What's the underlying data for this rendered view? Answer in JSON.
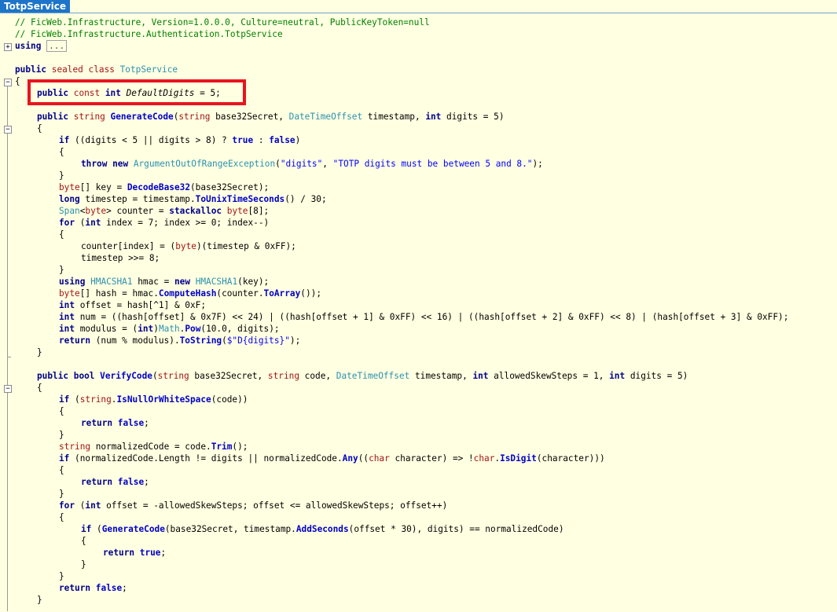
{
  "tab": {
    "title": "TotpService"
  },
  "highlight_label": "red box around DefaultDigits constant",
  "lines": [
    "// FicWeb.Infrastructure, Version=1.0.0.0, Culture=neutral, PublicKeyToken=null",
    "// FicWeb.Infrastructure.Authentication.TotpService",
    "using",
    "...",
    "public sealed class TotpService",
    "{",
    "public const int DefaultDigits = 5;",
    "public string GenerateCode(string base32Secret, DateTimeOffset timestamp, int digits = 5)",
    "if ((digits < 5 || digits > 8) ? true : false)",
    "throw new ArgumentOutOfRangeException(\"digits\", \"TOTP digits must be between 5 and 8.\");",
    "byte[] key = DecodeBase32(base32Secret);",
    "long timestep = timestamp.ToUnixTimeSeconds() / 30;",
    "Span<byte> counter = stackalloc byte[8];",
    "for (int index = 7; index >= 0; index--)",
    "counter[index] = (byte)(timestep & 0xFF);",
    "timestep >>= 8;",
    "using HMACSHA1 hmac = new HMACSHA1(key);",
    "byte[] hash = hmac.ComputeHash(counter.ToArray());",
    "int offset = hash[^1] & 0xF;",
    "int num = ((hash[offset] & 0x7F) << 24) | ((hash[offset + 1] & 0xFF) << 16) | ((hash[offset + 2] & 0xFF) << 8) | (hash[offset + 3] & 0xFF);",
    "int modulus = (int)Math.Pow(10.0, digits);",
    "return (num % modulus).ToString($\"D{digits}\");",
    "public bool VerifyCode(string base32Secret, string code, DateTimeOffset timestamp, int allowedSkewSteps = 1, int digits = 5)",
    "if (string.IsNullOrWhiteSpace(code))",
    "return false;",
    "string normalizedCode = code.Trim();",
    "if (normalizedCode.Length != digits || normalizedCode.Any((char character) => !char.IsDigit(character)))",
    "for (int offset = -allowedSkewSteps; offset <= allowedSkewSteps; offset++)",
    "if (GenerateCode(base32Secret, timestamp.AddSeconds(offset * 30), digits) == normalizedCode)",
    "return true;"
  ]
}
